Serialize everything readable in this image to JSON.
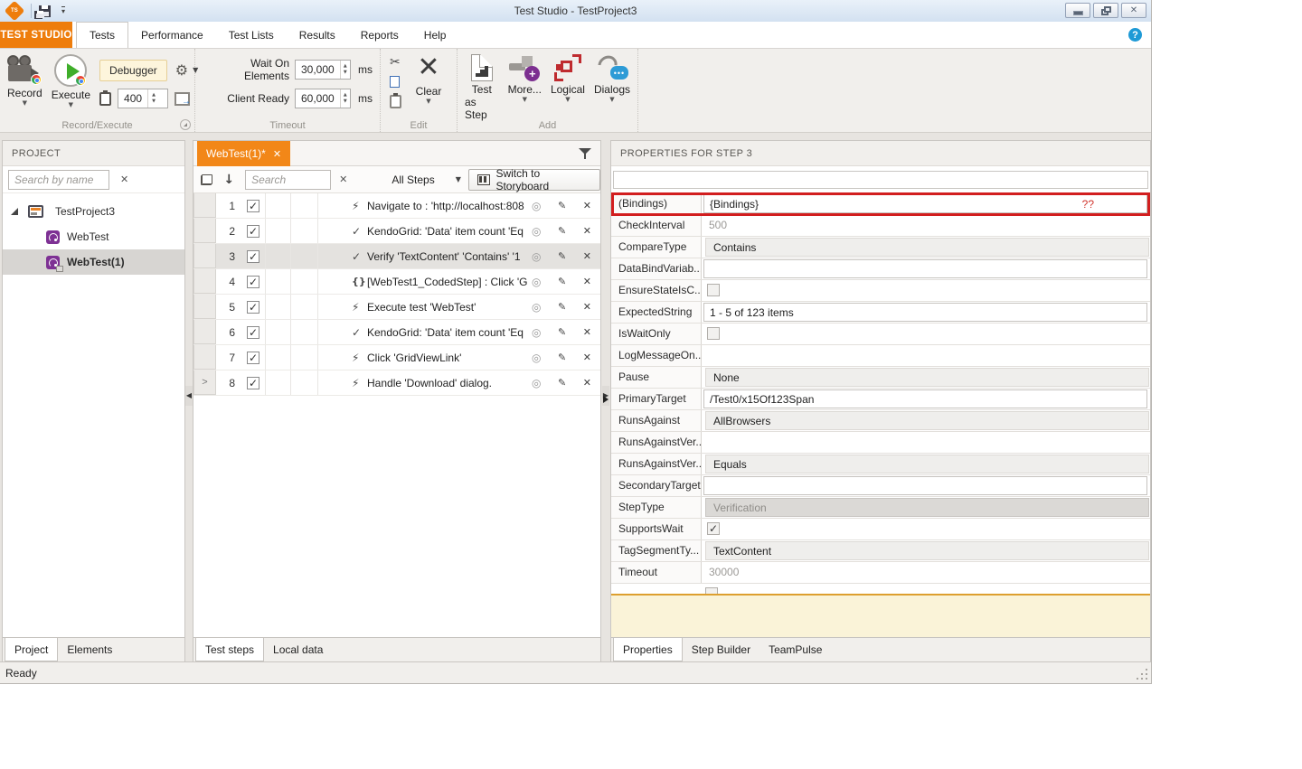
{
  "colors": {
    "accent_orange": "#ee7d0c",
    "tab_orange": "#f28718",
    "annotation_red": "#d21e1f",
    "note_yellow_bg": "#faf3d8",
    "note_yellow_border": "#dd9f2f",
    "help_blue": "#1e9ad6"
  },
  "window": {
    "title": "Test Studio - TestProject3",
    "status": "Ready"
  },
  "ribbon": {
    "app_button": "TEST STUDIO",
    "tabs": [
      "Tests",
      "Performance",
      "Test Lists",
      "Results",
      "Reports",
      "Help"
    ],
    "active_tab": "Tests",
    "record_execute": {
      "label": "Record/Execute",
      "record": "Record",
      "execute": "Execute",
      "debugger": "Debugger",
      "speed_value": "400"
    },
    "timeout": {
      "label": "Timeout",
      "wait_on_elements_label": "Wait On Elements",
      "wait_on_elements_value": "30,000",
      "client_ready_label": "Client Ready",
      "client_ready_value": "60,000",
      "ms": "ms"
    },
    "edit": {
      "label": "Edit",
      "clear": "Clear"
    },
    "add": {
      "label": "Add",
      "test_as_step_line1": "Test",
      "test_as_step_line2": "as Step",
      "more": "More...",
      "logical": "Logical",
      "dialogs": "Dialogs"
    }
  },
  "project_panel": {
    "title": "PROJECT",
    "search_placeholder": "Search by name",
    "tree": [
      {
        "label": "TestProject3",
        "type": "project",
        "expanded": true
      },
      {
        "label": "WebTest",
        "type": "webtest"
      },
      {
        "label": "WebTest(1)",
        "type": "webtest-modified",
        "selected": true
      }
    ],
    "tabs": [
      {
        "label": "Project",
        "active": true
      },
      {
        "label": "Elements",
        "active": false
      }
    ]
  },
  "steps_panel": {
    "tab_title": "WebTest(1)*",
    "search_placeholder": "Search",
    "filter_value": "All Steps",
    "storyboard_button": "Switch to Storyboard",
    "steps": [
      {
        "num": "1",
        "icon": "lightning",
        "text": "Navigate to : 'http://localhost:808",
        "checked": true
      },
      {
        "num": "2",
        "icon": "check",
        "text": "KendoGrid: 'Data' item count 'Eq",
        "checked": true
      },
      {
        "num": "3",
        "icon": "check",
        "text": "Verify 'TextContent' 'Contains' '1",
        "checked": true,
        "selected": true
      },
      {
        "num": "4",
        "icon": "coded",
        "text": "[WebTest1_CodedStep] : Click 'G",
        "checked": true
      },
      {
        "num": "5",
        "icon": "lightning",
        "text": "Execute test 'WebTest'",
        "checked": true
      },
      {
        "num": "6",
        "icon": "check",
        "text": "KendoGrid: 'Data' item count 'Eq",
        "checked": true
      },
      {
        "num": "7",
        "icon": "lightning",
        "text": "Click 'GridViewLink'",
        "checked": true
      },
      {
        "num": "8",
        "icon": "lightning",
        "text": "Handle 'Download' dialog.",
        "checked": true,
        "gutter": ">"
      }
    ],
    "tabs": [
      {
        "label": "Test steps",
        "active": true
      },
      {
        "label": "Local data",
        "active": false
      }
    ]
  },
  "properties_panel": {
    "title": "PROPERTIES FOR STEP 3",
    "rows": [
      {
        "name": "(Bindings)",
        "value": "{Bindings}",
        "style": "textbox",
        "highlight": true,
        "extra": "??"
      },
      {
        "name": "CheckInterval",
        "value": "500",
        "style": "muted"
      },
      {
        "name": "CompareType",
        "value": "Contains",
        "style": "dropdown"
      },
      {
        "name": "DataBindVariab...",
        "value": "",
        "style": "textbox"
      },
      {
        "name": "EnsureStateIsC...",
        "value": "",
        "style": "checkbox",
        "checked": false
      },
      {
        "name": "ExpectedString",
        "value": "1 - 5 of 123 items",
        "style": "textbox"
      },
      {
        "name": "IsWaitOnly",
        "value": "",
        "style": "checkbox",
        "checked": false
      },
      {
        "name": "LogMessageOn...",
        "value": "",
        "style": "plain"
      },
      {
        "name": "Pause",
        "value": "None",
        "style": "dropdown"
      },
      {
        "name": "PrimaryTarget",
        "value": "/Test0/x15Of123Span",
        "style": "textbox",
        "marker": true
      },
      {
        "name": "RunsAgainst",
        "value": "AllBrowsers",
        "style": "dropdown"
      },
      {
        "name": "RunsAgainstVer...",
        "value": "",
        "style": "plain"
      },
      {
        "name": "RunsAgainstVer...",
        "value": "Equals",
        "style": "dropdown"
      },
      {
        "name": "SecondaryTarget",
        "value": "",
        "style": "textbox"
      },
      {
        "name": "StepType",
        "value": "Verification",
        "style": "disabled"
      },
      {
        "name": "SupportsWait",
        "value": "",
        "style": "checkbox",
        "checked": true
      },
      {
        "name": "TagSegmentTy...",
        "value": "TextContent",
        "style": "dropdown"
      },
      {
        "name": "Timeout",
        "value": "30000",
        "style": "muted"
      }
    ],
    "tabs": [
      {
        "label": "Properties",
        "active": true
      },
      {
        "label": "Step Builder",
        "active": false
      },
      {
        "label": "TeamPulse",
        "active": false
      }
    ]
  },
  "icons": {
    "lightning": "⚡",
    "check": "✓",
    "coded": "{}",
    "target": "◎",
    "edit": "✎",
    "delete": "✕",
    "checkmark": "✓"
  }
}
